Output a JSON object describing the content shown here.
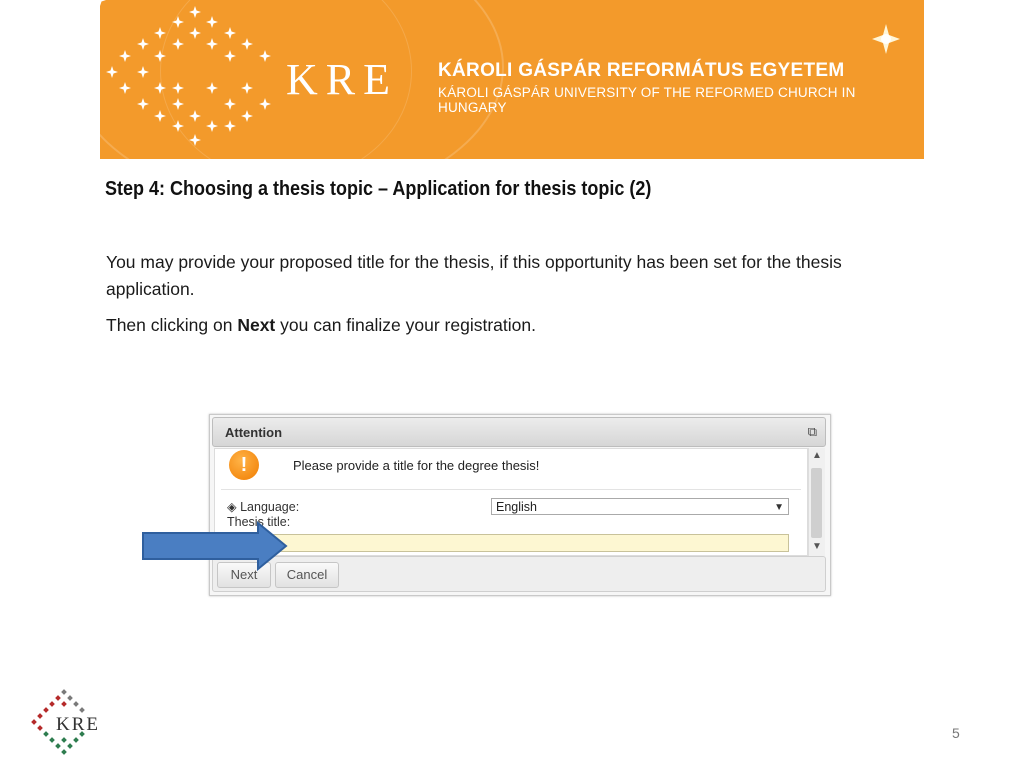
{
  "banner": {
    "logo_text": "KRE",
    "university_hu": "KÁROLI GÁSPÁR REFORMÁTUS EGYETEM",
    "university_en": "KÁROLI GÁSPÁR UNIVERSITY OF THE REFORMED CHURCH IN HUNGARY",
    "background_color": "#f39a2b"
  },
  "slide": {
    "title": "Step 4: Choosing a thesis topic – Application for thesis topic (2)",
    "paragraph1": "You may provide your proposed title for the thesis, if this opportunity has been set for the thesis application.",
    "paragraph2_prefix": "Then clicking on ",
    "paragraph2_bold": "Next",
    "paragraph2_suffix": " you can finalize your registration."
  },
  "dialog": {
    "title": "Attention",
    "popout_icon": "popout-icon",
    "warning_icon": "warning-icon",
    "warning_symbol": "!",
    "message": "Please provide a title for the degree thesis!",
    "language_label": "Language:",
    "language_value": "English",
    "thesis_title_label": "Thesis title:",
    "thesis_title_value": "",
    "next_label": "Next",
    "cancel_label": "Cancel",
    "input_highlight_color": "#fdf7d2"
  },
  "annotation": {
    "arrow_icon": "arrow-right-icon",
    "arrow_color": "#4a7ec2"
  },
  "footer": {
    "logo_text": "KRE",
    "page_number": "5"
  }
}
